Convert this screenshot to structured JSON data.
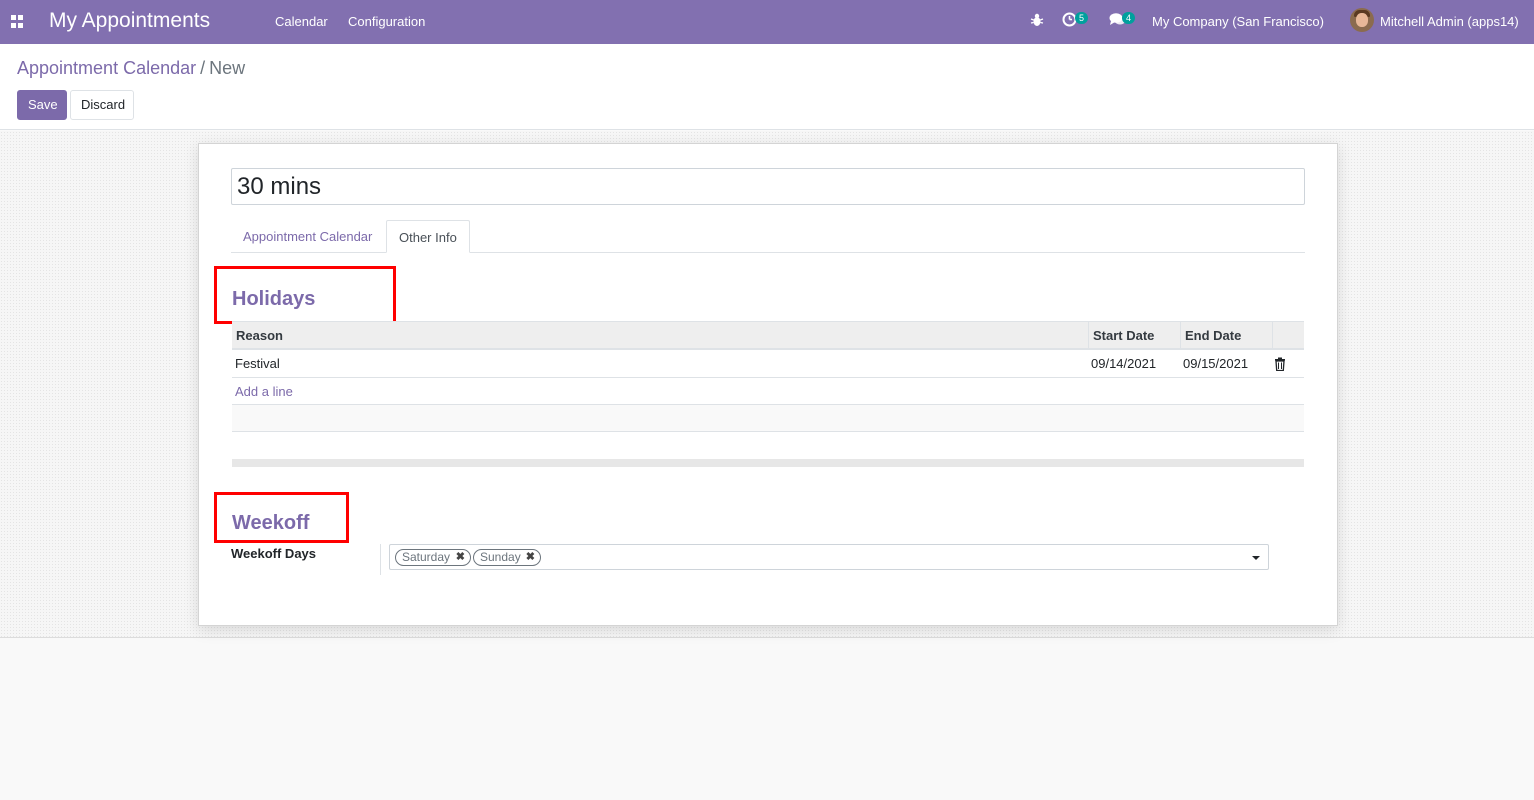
{
  "navbar": {
    "app_title": "My Appointments",
    "menus": [
      "Calendar",
      "Configuration"
    ],
    "activity_count": "5",
    "message_count": "4",
    "company": "My Company (San Francisco)",
    "user": "Mitchell Admin (apps14)",
    "icons": [
      "apps-icon",
      "bug-icon",
      "clock-icon",
      "chat-icon",
      "avatar"
    ],
    "color": "#8270b0"
  },
  "breadcrumb": {
    "parent": "Appointment Calendar",
    "separator": "/",
    "current": "New"
  },
  "buttons": {
    "save": "Save",
    "discard": "Discard"
  },
  "form": {
    "name_value": "30 mins",
    "tabs": [
      "Appointment Calendar",
      "Other Info"
    ],
    "active_tab": "Other Info",
    "holidays_title": "Holidays",
    "holidays_table": {
      "columns": [
        "Reason",
        "Start Date",
        "End Date"
      ],
      "rows": [
        {
          "reason": "Festival",
          "start": "09/14/2021",
          "end": "09/15/2021"
        }
      ],
      "add_line": "Add a line"
    },
    "weekoff_title": "Weekoff",
    "weekoff_label": "Weekoff Days",
    "weekoff_tags": [
      "Saturday",
      "Sunday"
    ]
  },
  "colors": {
    "accent": "#7c6aaa",
    "highlight_box": "#ff0000"
  }
}
